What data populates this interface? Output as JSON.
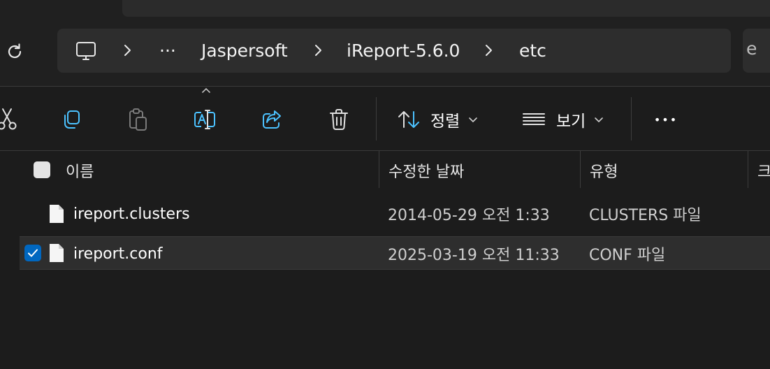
{
  "address_bar": {
    "overflow_label": "···",
    "crumbs": [
      "Jaspersoft",
      "iReport-5.6.0",
      "etc"
    ],
    "search_partial": "e"
  },
  "toolbar": {
    "sort_label": "정렬",
    "view_label": "보기",
    "more_label": "•••"
  },
  "columns": {
    "name": "이름",
    "modified": "수정한 날짜",
    "type": "유형",
    "size_partial": "크"
  },
  "files": [
    {
      "name": "ireport.clusters",
      "modified": "2014-05-29 오전 1:33",
      "type": "CLUSTERS 파일",
      "selected": false
    },
    {
      "name": "ireport.conf",
      "modified": "2025-03-19 오전 11:33",
      "type": "CONF 파일",
      "selected": true
    }
  ],
  "colors": {
    "accent": "#0067c0",
    "icon_blue": "#4cc2ff"
  }
}
